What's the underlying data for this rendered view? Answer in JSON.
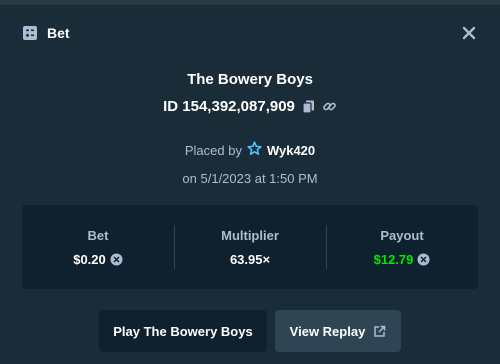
{
  "header": {
    "title": "Bet",
    "icon": "bet-slip-icon",
    "close_icon": "close-icon"
  },
  "bet": {
    "game_name": "The Bowery Boys",
    "id_text": "ID 154,392,087,909",
    "placed_by_label": "Placed by",
    "username": "Wyk420",
    "date_text": "on 5/1/2023 at 1:50 PM"
  },
  "stats": {
    "bet_label": "Bet",
    "bet_value": "$0.20",
    "multiplier_label": "Multiplier",
    "multiplier_value": "63.95×",
    "payout_label": "Payout",
    "payout_value": "$12.79"
  },
  "actions": {
    "play_label": "Play The Bowery Boys",
    "replay_label": "View Replay"
  },
  "colors": {
    "background": "#1a2c38",
    "panel": "#0f212e",
    "secondary_button": "#2f4553",
    "muted_text": "#b1bad3",
    "payout_green": "#00e701",
    "user_star": "#4fc3ff"
  }
}
